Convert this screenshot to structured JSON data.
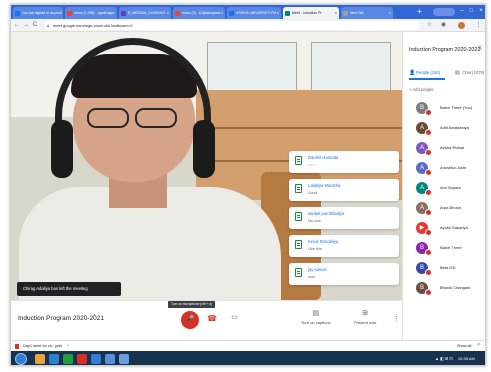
{
  "browser": {
    "tabs": [
      {
        "label": "You are signed in as jeo.2",
        "favicon_color": "#1a73e8",
        "active": false
      },
      {
        "label": "Inbox (1,285) - ngofmagu",
        "favicon_color": "#ea4335",
        "active": false
      },
      {
        "label": "B_MEDIUM_11/09/2021",
        "favicon_color": "#673ab7",
        "active": false
      },
      {
        "label": "Inbox (0) - k2@atmiyaun",
        "favicon_color": "#ea4335",
        "active": false
      },
      {
        "label": "ATMIYA UNIVERSITY Ful",
        "favicon_color": "#1a73e8",
        "active": false
      },
      {
        "label": "Meet - Induction Pr",
        "favicon_color": "#00897b",
        "active": true
      },
      {
        "label": "New Tab",
        "favicon_color": "#9aa0a6",
        "active": false
      }
    ],
    "tab_close_glyph": "×",
    "new_tab_glyph": "+",
    "url": "meet.google.com/mgk-xcwe-ckk?authuser=0",
    "nav": {
      "back": "←",
      "forward": "→",
      "reload": "C",
      "home": "⌂"
    },
    "icons": {
      "star": "☆",
      "menu": "⋮",
      "extensions": "◉"
    },
    "window_controls": {
      "minimize": "–",
      "maximize": "□",
      "close": "×"
    }
  },
  "meet": {
    "meeting_title": "Induction Program 2020-2021",
    "chevron": "^",
    "left_notification": "Chirag Adaliya has left the meeting",
    "mic_tooltip": "Turn on microphone (ctrl + d)",
    "mic_glyph": "🎤",
    "hangup_glyph": "☎",
    "camera_glyph": "▭",
    "more_glyph": "⋮",
    "captions": {
      "label": "Turn on captions",
      "icon": "▤"
    },
    "present": {
      "label": "Present now",
      "icon": "⊞"
    },
    "chat_messages": [
      {
        "name": "Darshit Harsoda",
        "text": "::::::::"
      },
      {
        "name": "Lalakiya Manisha",
        "text": "Good"
      },
      {
        "name": "sanket pumbhadiya",
        "text": "No voic"
      },
      {
        "name": "Keval Dondaliya",
        "text": "Like this"
      },
      {
        "name": "jay kanani",
        "text": "now"
      }
    ]
  },
  "panel": {
    "title": "Induction Program 2020-2021",
    "close_glyph": "X",
    "people_tab": "People (152)",
    "chat_tab": "Chat (1079)",
    "add_people": "Add people",
    "people_icon": "👤",
    "chat_icon": "▤",
    "add_icon": "+",
    "participants": [
      {
        "name": "Batch Three (You)",
        "initial": "B",
        "color": "#7d7d7d",
        "muted": true
      },
      {
        "name": "Aditi Aaradaniya",
        "initial": "A",
        "color": "#6b4a35",
        "muted": true
      },
      {
        "name": "Aesha Rokad",
        "initial": "A",
        "color": "#7e57c2",
        "muted": true
      },
      {
        "name": "Anushka Joshi",
        "initial": "A",
        "color": "#5c6bc0",
        "muted": true
      },
      {
        "name": "Arvi Shyara",
        "initial": "A",
        "color": "#00897b",
        "muted": true
      },
      {
        "name": "Arpa Bhuva",
        "initial": "A",
        "color": "#8d6e63",
        "muted": true
      },
      {
        "name": "Ayush Sakariya",
        "initial": "▶",
        "color": "#e53935",
        "muted": true
      },
      {
        "name": "Batch Three",
        "initial": "B",
        "color": "#8e24aa",
        "muted": true
      },
      {
        "name": "Beta D3i",
        "initial": "B",
        "color": "#3949ab",
        "muted": true
      },
      {
        "name": "Bhavik Changani",
        "initial": "B",
        "color": "#6d4c41",
        "muted": true
      }
    ]
  },
  "downloads": {
    "file": "Day1 meet for ch...pptx",
    "chevron": "^",
    "show_all": "Show all",
    "close_glyph": "×"
  },
  "taskbar": {
    "time": "10:35 AM",
    "tray": "▲ ◧ ⊞ ⊡",
    "apps": [
      "#e8a33c",
      "#2f7fd1",
      "#1e9e3e",
      "#d93025",
      "#2f7fd1",
      "#5a8fd8",
      "#6aa0e0"
    ]
  }
}
